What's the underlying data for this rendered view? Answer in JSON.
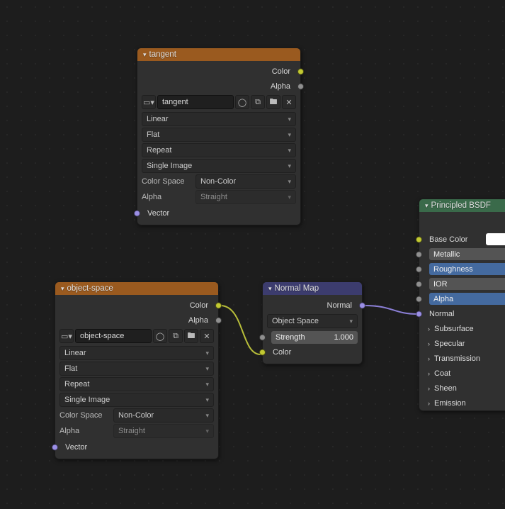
{
  "nodes": {
    "tangent": {
      "title": "tangent",
      "outputs": {
        "color": "Color",
        "alpha": "Alpha"
      },
      "texName": "tangent",
      "interpolation": "Linear",
      "projection": "Flat",
      "extension": "Repeat",
      "source": "Single Image",
      "colorSpaceLabel": "Color Space",
      "colorSpace": "Non-Color",
      "alphaLabel": "Alpha",
      "alphaMode": "Straight",
      "vector": "Vector"
    },
    "objectSpace": {
      "title": "object-space",
      "outputs": {
        "color": "Color",
        "alpha": "Alpha"
      },
      "texName": "object-space",
      "interpolation": "Linear",
      "projection": "Flat",
      "extension": "Repeat",
      "source": "Single Image",
      "colorSpaceLabel": "Color Space",
      "colorSpace": "Non-Color",
      "alphaLabel": "Alpha",
      "alphaMode": "Straight",
      "vector": "Vector"
    },
    "normalMap": {
      "title": "Normal Map",
      "output": "Normal",
      "space": "Object Space",
      "strengthLabel": "Strength",
      "strengthValue": "1.000",
      "colorInput": "Color"
    },
    "principled": {
      "title": "Principled BSDF",
      "baseColorLabel": "Base Color",
      "metallic": "Metallic",
      "roughness": "Roughness",
      "ior": "IOR",
      "alpha": "Alpha",
      "normal": "Normal",
      "subsurface": "Subsurface",
      "specular": "Specular",
      "transmission": "Transmission",
      "coat": "Coat",
      "sheen": "Sheen",
      "emission": "Emission"
    }
  }
}
